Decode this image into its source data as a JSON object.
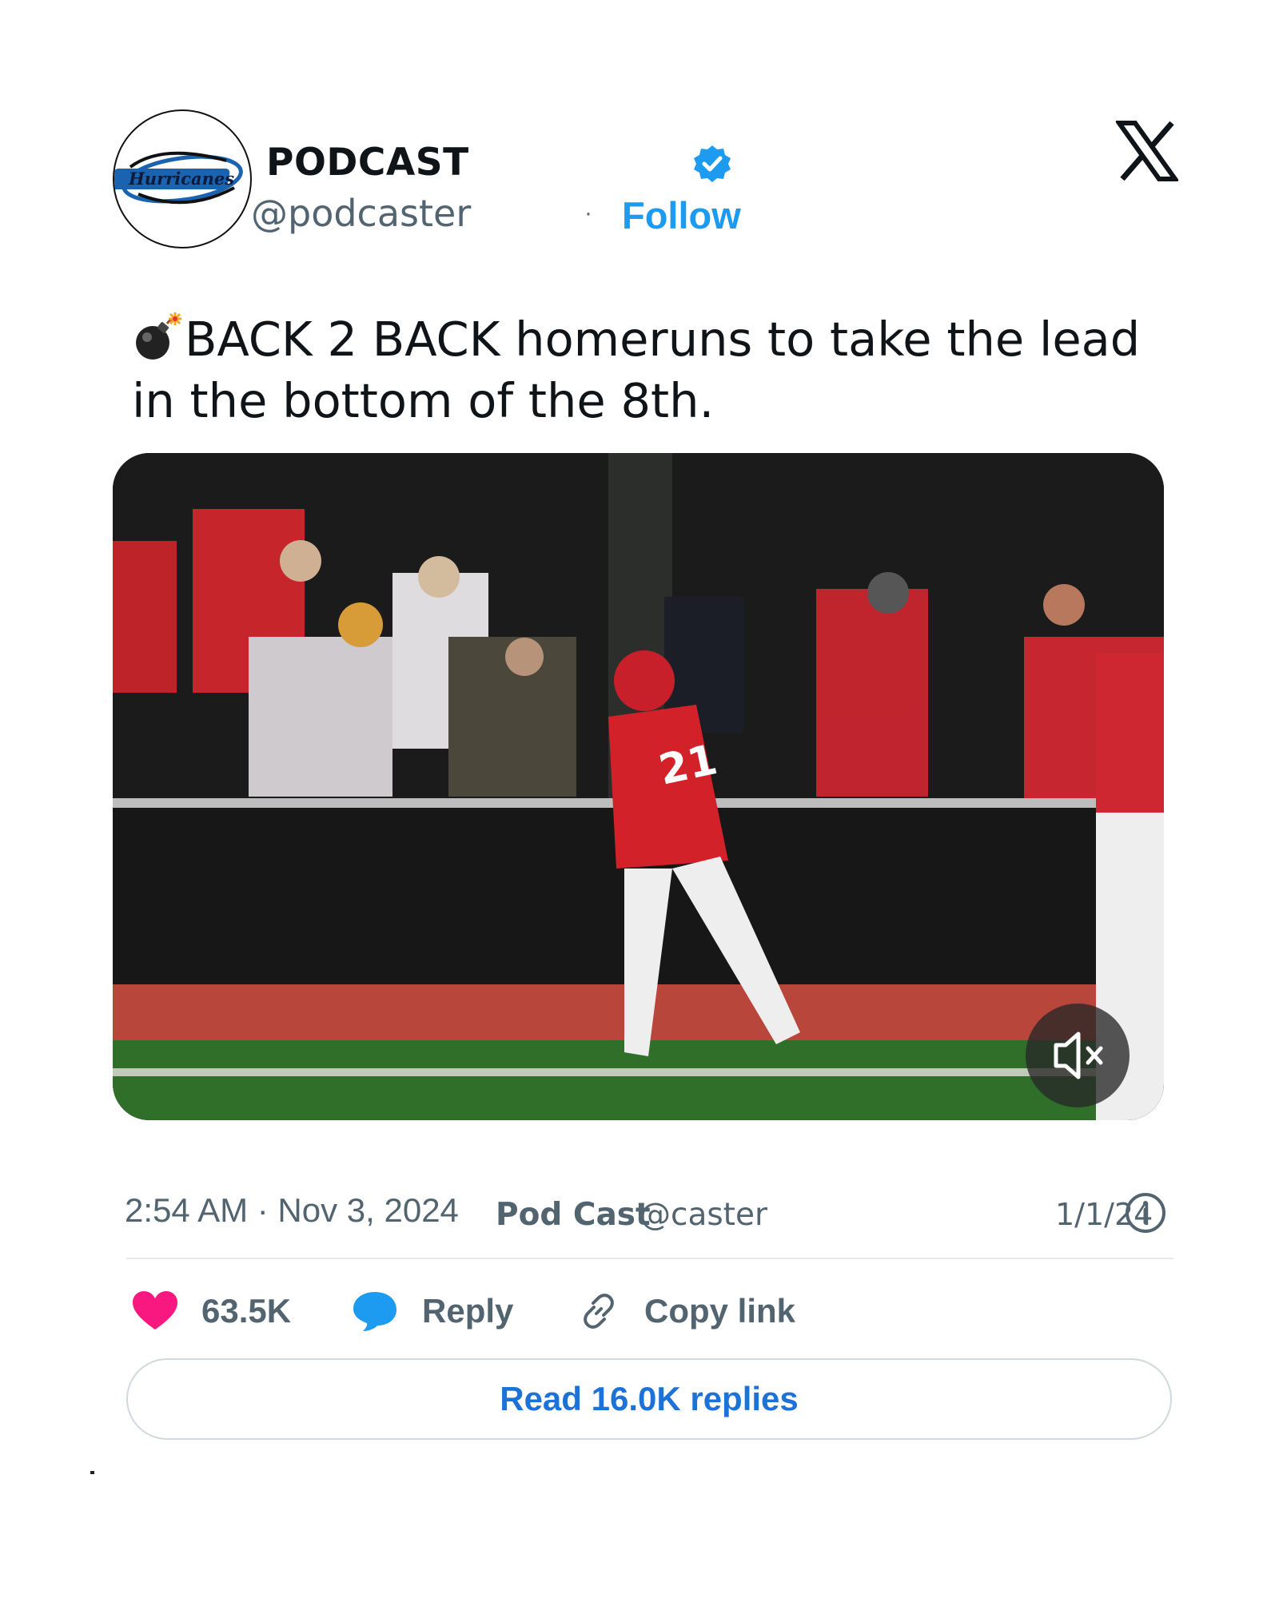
{
  "header": {
    "avatar_logo_text": "Hurricanes",
    "display_name": "PODCAST",
    "handle": "@podcaster",
    "separator": "·",
    "follow_label": "Follow",
    "verified_icon": "verified-badge-icon",
    "platform_icon": "x-logo-icon"
  },
  "tweet": {
    "emoji_icon": "bomb-icon",
    "text": "BACK 2 BACK homeruns to take the lead in the bottom of the 8th."
  },
  "media": {
    "type": "video",
    "player_number": "21",
    "mute_icon": "volume-muted-icon"
  },
  "meta": {
    "time": "2:54 AM · Nov 3, 2024",
    "author_name": "Pod Cast",
    "author_handle": "@caster",
    "date_short": "1/1/24",
    "info_icon": "info-icon"
  },
  "actions": {
    "likes_count": "63.5K",
    "reply_label": "Reply",
    "copy_label": "Copy link",
    "read_replies_label": "Read 16.0K replies"
  },
  "colors": {
    "accent_blue": "#1d9bf0",
    "like_pink": "#f91880",
    "text_secondary": "#536471"
  }
}
